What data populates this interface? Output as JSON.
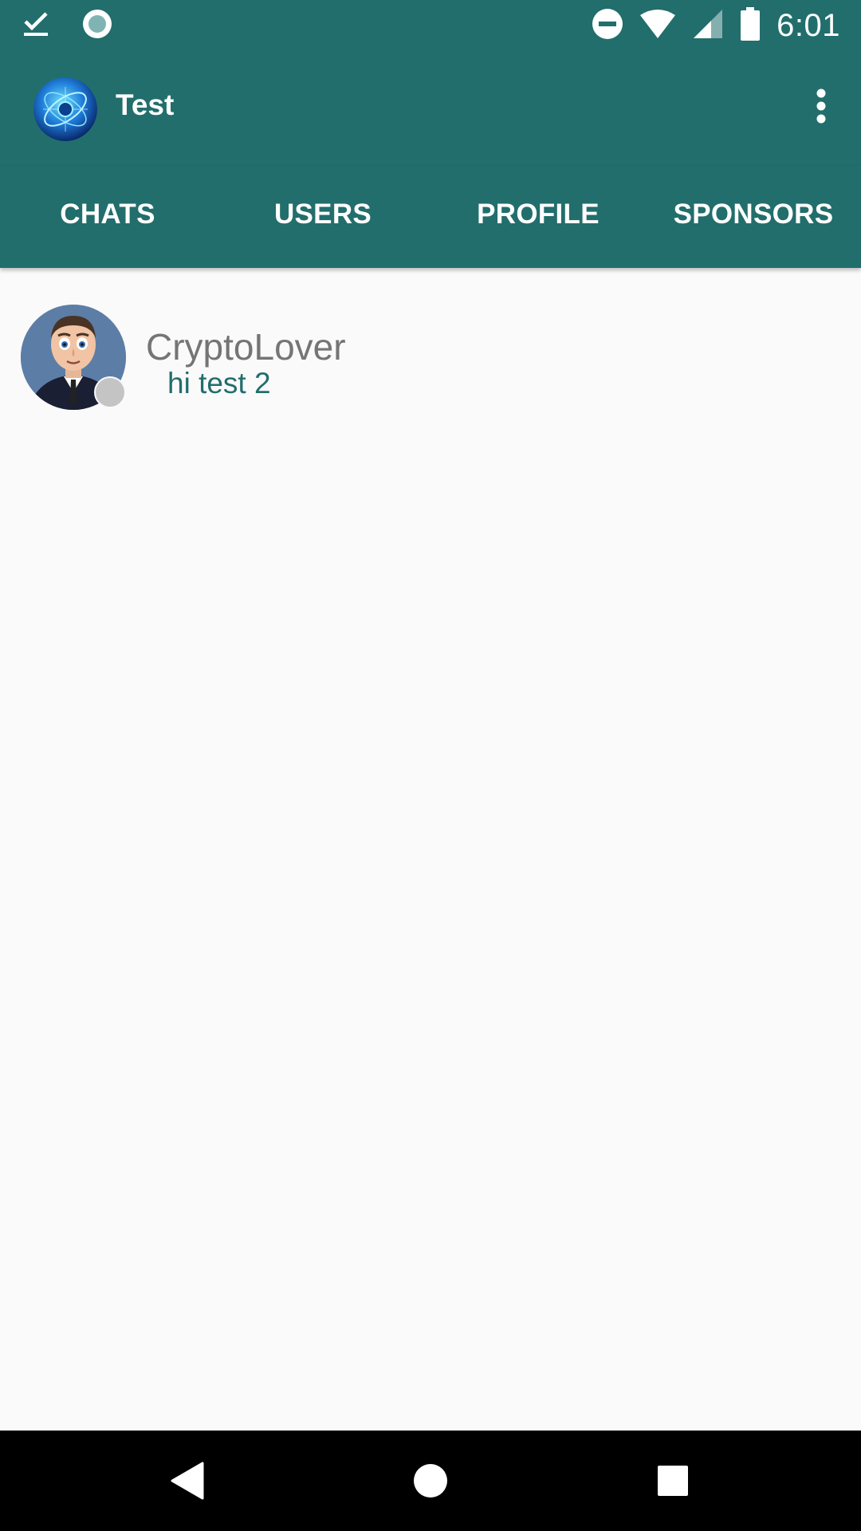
{
  "status_bar": {
    "time": "6:01",
    "icons": [
      "check-download-icon",
      "circle-notification-icon",
      "do-not-disturb-icon",
      "wifi-icon",
      "signal-icon",
      "battery-icon"
    ]
  },
  "app_bar": {
    "title": "Test",
    "logo": "globe-logo",
    "overflow_icon": "more-vert-icon"
  },
  "tabs": [
    {
      "label": "CHATS"
    },
    {
      "label": "USERS"
    },
    {
      "label": "PROFILE"
    },
    {
      "label": "SPONSORS"
    }
  ],
  "chats": [
    {
      "name": "CryptoLover",
      "last_message": "hi test 2",
      "status": "offline",
      "status_color": "#c4c4c4"
    }
  ],
  "nav_bar": {
    "icons": [
      "back-icon",
      "home-icon",
      "recents-icon"
    ]
  },
  "colors": {
    "primary": "#226e6c",
    "background": "#fafafa",
    "name_text": "#757575"
  }
}
